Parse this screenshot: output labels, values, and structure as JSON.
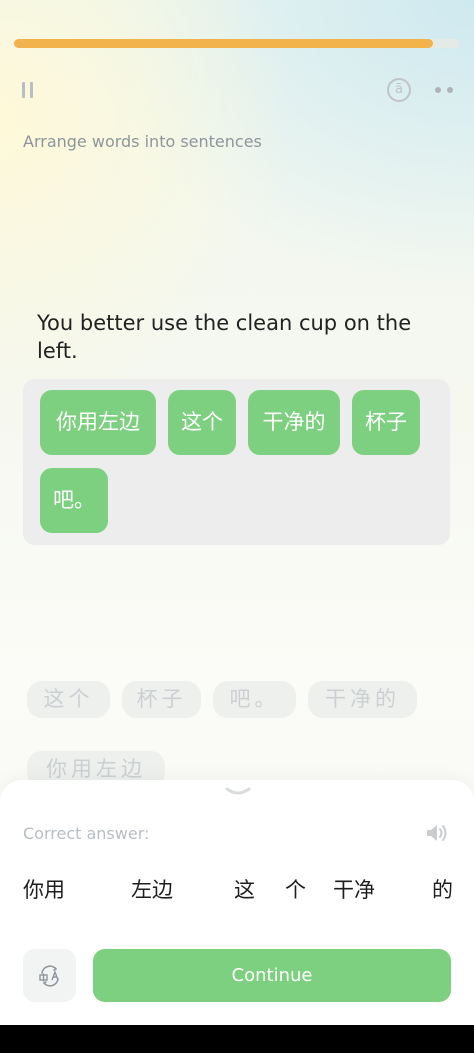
{
  "progress": {
    "fraction": 0.94,
    "color": "#f2b24c"
  },
  "header": {
    "pause_icon": "pause-icon",
    "hint_icon": "pinyin-hint-icon",
    "hint_glyph": "ā",
    "more_icon": "more-icon"
  },
  "exercise": {
    "instruction": "Arrange words into sentences",
    "prompt": "You better use the clean cup on the left."
  },
  "answer_area": {
    "chips": [
      "你用左边",
      "这个",
      "干净的",
      "杯子",
      "吧。"
    ]
  },
  "word_bank": {
    "chips": [
      "这个",
      "杯子",
      "吧。",
      "干净的",
      "你用左边"
    ]
  },
  "result_sheet": {
    "correct_label": "Correct answer:",
    "answer_words": [
      "你用",
      "左边",
      "这",
      "个",
      "干净",
      "的"
    ],
    "continue_label": "Continue",
    "accent_color": "#7dd07f"
  }
}
